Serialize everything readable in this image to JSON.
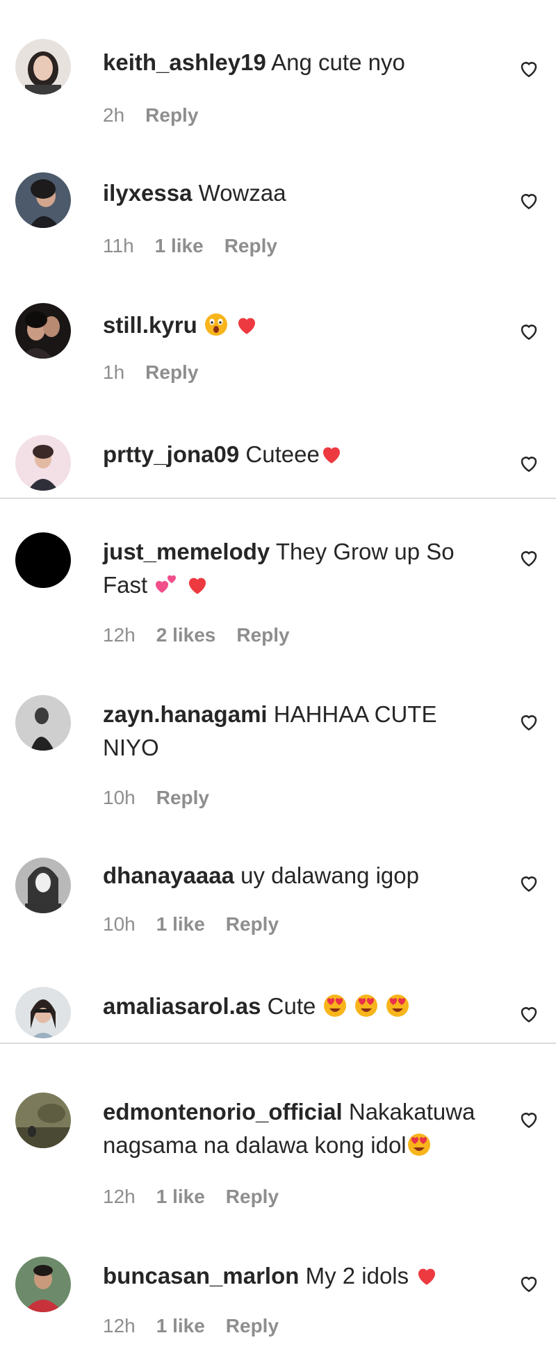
{
  "comments": [
    {
      "username": "keith_ashley19",
      "text": " Ang cute nyo",
      "time": "2h",
      "likes": "",
      "reply": "Reply",
      "emojis": []
    },
    {
      "username": "ilyxessa",
      "text": " Wowzaa",
      "time": "11h",
      "likes": "1 like",
      "reply": "Reply",
      "emojis": []
    },
    {
      "username": "still.kyru",
      "text": "",
      "time": "1h",
      "likes": "",
      "reply": "Reply",
      "emojis": [
        "astonished-face-emoji",
        "red-heart-emoji"
      ]
    },
    {
      "username": "prtty_jona09",
      "text": " Cuteee",
      "time": "",
      "likes": "",
      "reply": "",
      "emojis": [
        "red-heart-emoji"
      ]
    },
    {
      "username": "just_memelody",
      "text": " They Grow up So Fast",
      "time": "12h",
      "likes": "2 likes",
      "reply": "Reply",
      "emojis": [
        "two-hearts-emoji",
        "red-heart-emoji"
      ]
    },
    {
      "username": "zayn.hanagami",
      "text": " HAHHAA CUTE NIYO",
      "time": "10h",
      "likes": "",
      "reply": "Reply",
      "emojis": []
    },
    {
      "username": "dhanayaaaa",
      "text": " uy dalawang igop",
      "time": "10h",
      "likes": "1 like",
      "reply": "Reply",
      "emojis": []
    },
    {
      "username": "amaliasarol.as",
      "text": " Cute",
      "time": "",
      "likes": "",
      "reply": "",
      "emojis": [
        "heart-eyes-emoji",
        "heart-eyes-emoji",
        "heart-eyes-emoji"
      ]
    },
    {
      "username": "edmontenorio_official",
      "text": " Nakakatuwa nagsama na dalawa kong idol",
      "time": "12h",
      "likes": "1 like",
      "reply": "Reply",
      "emojis": [
        "heart-eyes-emoji"
      ]
    },
    {
      "username": "buncasan_marlon",
      "text": " My 2 idols",
      "time": "12h",
      "likes": "1 like",
      "reply": "Reply",
      "emojis": [
        "red-heart-emoji"
      ]
    }
  ],
  "colors": {
    "text": "#262626",
    "meta": "#8e8e8e",
    "divider": "#dbdbdb",
    "heart_red": "#ed3a40",
    "emoji_yellow": "#f7b51b"
  }
}
